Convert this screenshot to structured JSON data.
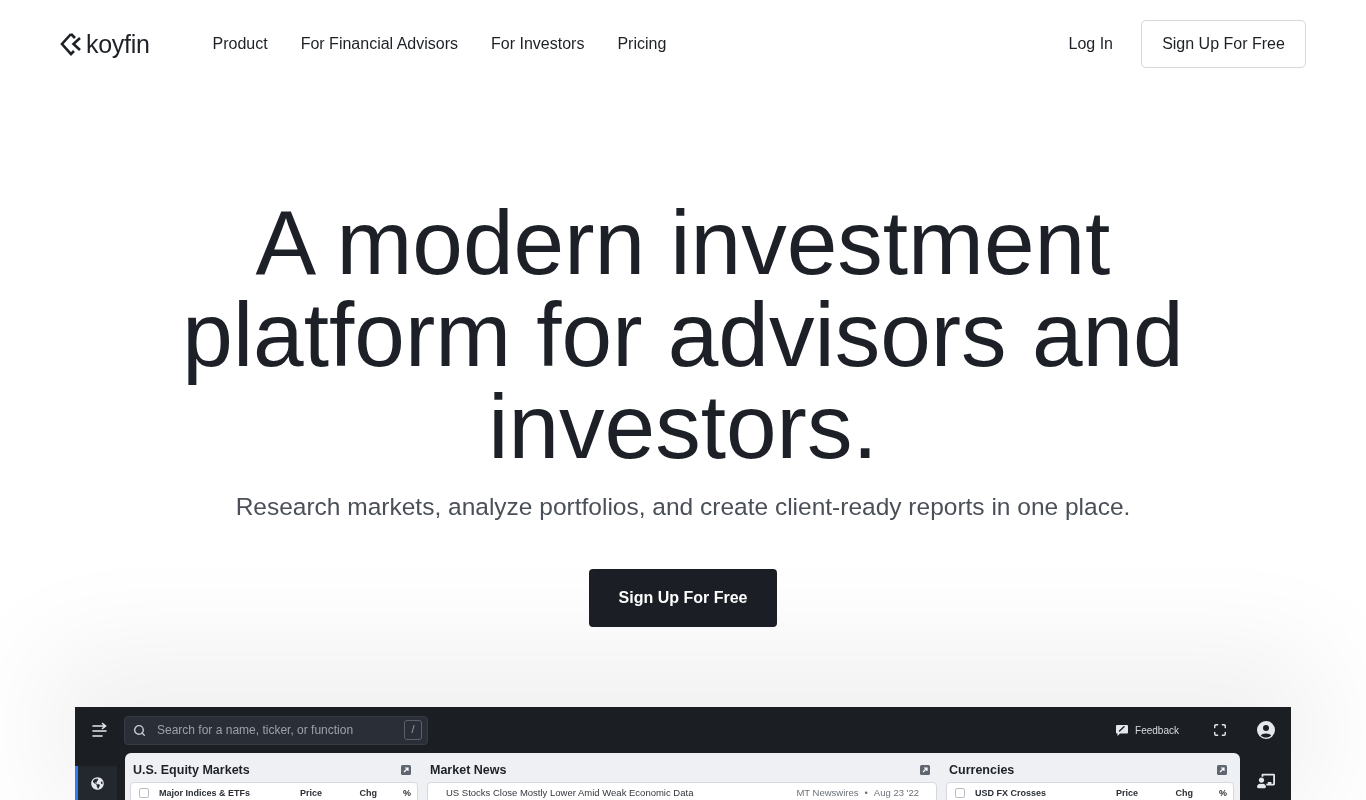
{
  "header": {
    "logo": "koyfin",
    "nav": [
      "Product",
      "For Financial Advisors",
      "For Investors",
      "Pricing"
    ],
    "login": "Log In",
    "signup": "Sign Up For Free"
  },
  "hero": {
    "headline": "A modern investment platform for advisors and investors.",
    "subtitle": "Research markets, analyze portfolios, and create client-ready reports in one place.",
    "cta": "Sign Up For Free"
  },
  "app_preview": {
    "search": {
      "placeholder": "Search for a name, ticker, or function",
      "shortcut": "/"
    },
    "feedback": "Feedback",
    "left_nav": [
      {
        "selected": true
      }
    ],
    "panels": [
      {
        "kind": "table",
        "title": "U.S. Equity Markets",
        "checked": false,
        "columns": [
          "Major Indices & ETFs",
          "Price",
          "Chg",
          "%"
        ]
      },
      {
        "kind": "news",
        "title": "Market News",
        "items": [
          {
            "headline": "US Stocks Close Mostly Lower Amid Weak Economic Data",
            "source": "MT Newswires",
            "separator": "•",
            "date": "Aug 23 '22"
          }
        ]
      },
      {
        "kind": "table",
        "title": "Currencies",
        "checked": false,
        "columns": [
          "USD FX Crosses",
          "Price",
          "Chg",
          "%"
        ]
      }
    ]
  }
}
